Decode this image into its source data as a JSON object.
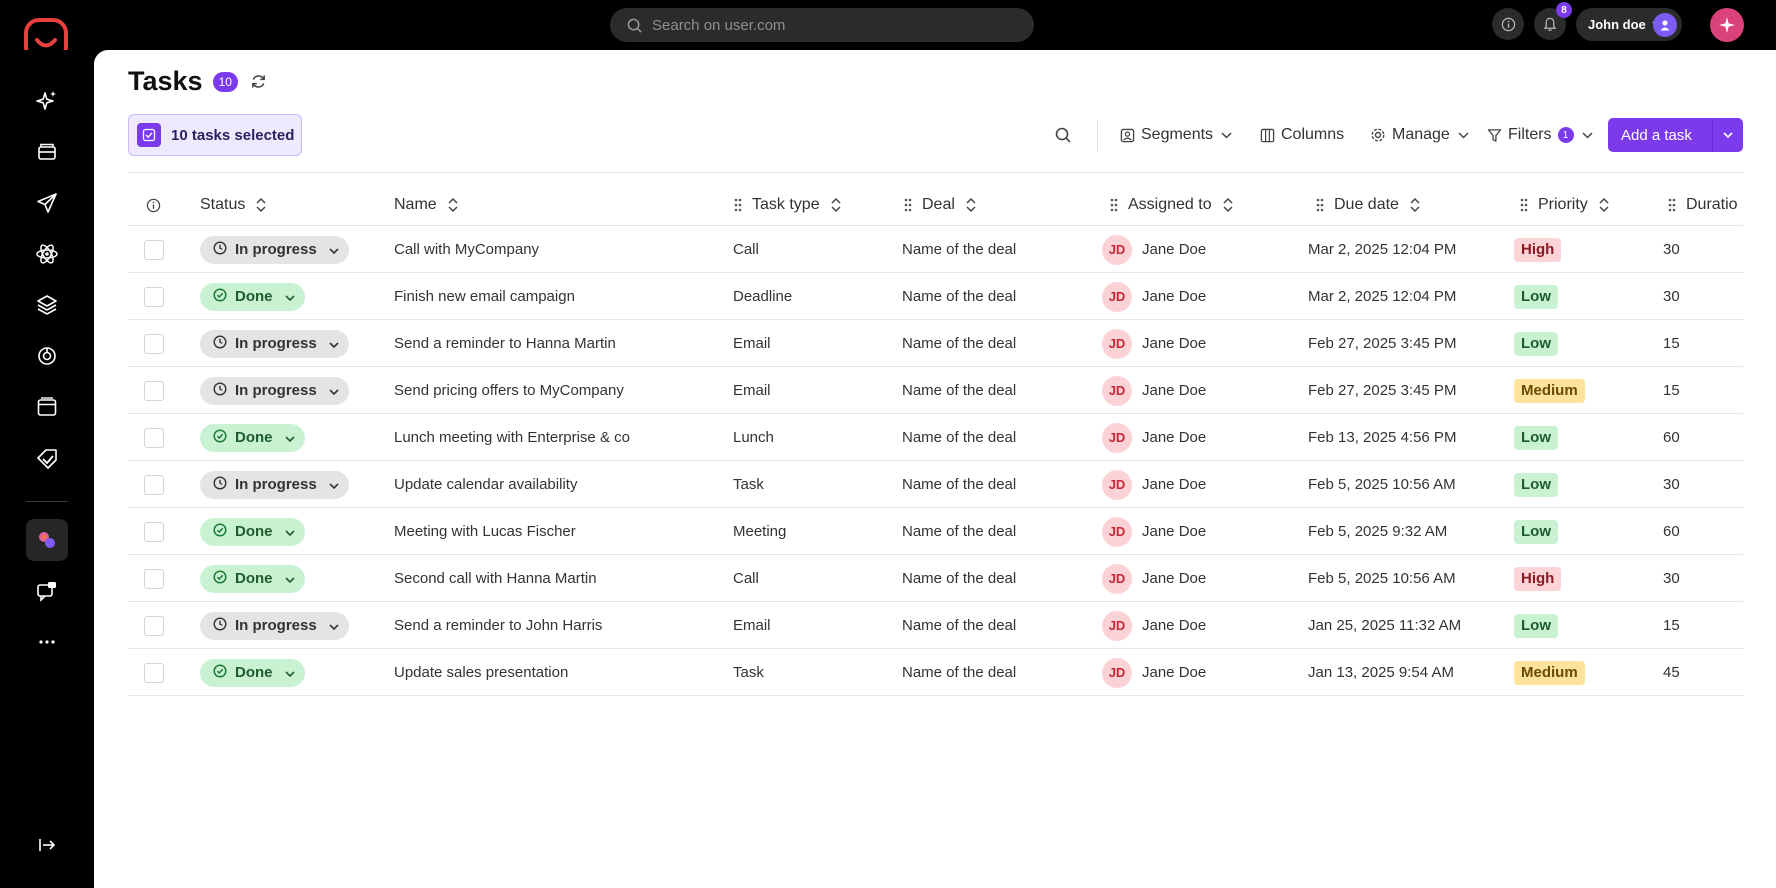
{
  "header": {
    "search_placeholder": "Search on user.com",
    "notification_count": "8",
    "user_name": "John doe"
  },
  "page": {
    "title": "Tasks",
    "count": "10",
    "selected_label": "10 tasks selected"
  },
  "toolbar": {
    "segments": "Segments",
    "columns": "Columns",
    "manage": "Manage",
    "filters": "Filters",
    "filters_count": "1",
    "add_task": "Add a task"
  },
  "table": {
    "headers": {
      "status": "Status",
      "name": "Name",
      "task_type": "Task type",
      "deal": "Deal",
      "assigned_to": "Assigned to",
      "due_date": "Due date",
      "priority": "Priority",
      "duration": "Duratio"
    },
    "rows": [
      {
        "status": "In progress",
        "status_key": "inprogress",
        "name": "Call with MyCompany",
        "type": "Call",
        "deal": "Name of the deal",
        "initials": "JD",
        "assignee": "Jane Doe",
        "due": "Mar 2, 2025 12:04 PM",
        "priority": "High",
        "duration": "30"
      },
      {
        "status": "Done",
        "status_key": "done",
        "name": "Finish new email campaign",
        "type": "Deadline",
        "deal": "Name of the deal",
        "initials": "JD",
        "assignee": "Jane Doe",
        "due": "Mar 2, 2025 12:04 PM",
        "priority": "Low",
        "duration": "30"
      },
      {
        "status": "In progress",
        "status_key": "inprogress",
        "name": "Send a reminder to Hanna Martin",
        "type": "Email",
        "deal": "Name of the deal",
        "initials": "JD",
        "assignee": "Jane Doe",
        "due": "Feb 27, 2025 3:45 PM",
        "priority": "Low",
        "duration": "15"
      },
      {
        "status": "In progress",
        "status_key": "inprogress",
        "name": "Send pricing offers to MyCompany",
        "type": "Email",
        "deal": "Name of the deal",
        "initials": "JD",
        "assignee": "Jane Doe",
        "due": "Feb 27, 2025 3:45 PM",
        "priority": "Medium",
        "duration": "15"
      },
      {
        "status": "Done",
        "status_key": "done",
        "name": "Lunch meeting with Enterprise & co",
        "type": "Lunch",
        "deal": "Name of the deal",
        "initials": "JD",
        "assignee": "Jane Doe",
        "due": "Feb 13, 2025 4:56 PM",
        "priority": "Low",
        "duration": "60"
      },
      {
        "status": "In progress",
        "status_key": "inprogress",
        "name": "Update calendar availability",
        "type": "Task",
        "deal": "Name of the deal",
        "initials": "JD",
        "assignee": "Jane Doe",
        "due": "Feb 5, 2025 10:56 AM",
        "priority": "Low",
        "duration": "30"
      },
      {
        "status": "Done",
        "status_key": "done",
        "name": "Meeting with Lucas Fischer",
        "type": "Meeting",
        "deal": "Name of the deal",
        "initials": "JD",
        "assignee": "Jane Doe",
        "due": "Feb 5, 2025 9:32 AM",
        "priority": "Low",
        "duration": "60"
      },
      {
        "status": "Done",
        "status_key": "done",
        "name": "Second call with Hanna Martin",
        "type": "Call",
        "deal": "Name of the deal",
        "initials": "JD",
        "assignee": "Jane Doe",
        "due": "Feb 5, 2025 10:56 AM",
        "priority": "High",
        "duration": "30"
      },
      {
        "status": "In progress",
        "status_key": "inprogress",
        "name": "Send a reminder to John Harris",
        "type": "Email",
        "deal": "Name of the deal",
        "initials": "JD",
        "assignee": "Jane Doe",
        "due": "Jan 25, 2025 11:32 AM",
        "priority": "Low",
        "duration": "15"
      },
      {
        "status": "Done",
        "status_key": "done",
        "name": "Update sales presentation",
        "type": "Task",
        "deal": "Name of the deal",
        "initials": "JD",
        "assignee": "Jane Doe",
        "due": "Jan 13, 2025 9:54 AM",
        "priority": "Medium",
        "duration": "45"
      }
    ]
  },
  "sidebar": {
    "items": [
      "ai-sparkle-icon",
      "inbox-icon",
      "send-icon",
      "atom-icon",
      "layers-icon",
      "analytics-icon",
      "browser-window-icon",
      "tag-icon",
      "crm-icon",
      "chat-icon",
      "more-icon"
    ]
  },
  "colors": {
    "accent": "#7c3aed",
    "brand": "#e8413d"
  }
}
